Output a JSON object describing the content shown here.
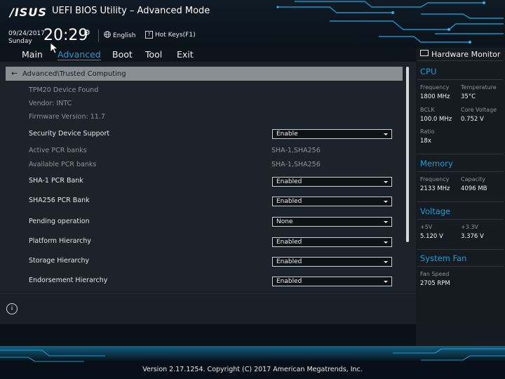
{
  "header": {
    "brand": "/ISUS",
    "title": "UEFI BIOS Utility – Advanced Mode",
    "date": "09/24/2017",
    "day": "Sunday",
    "time": "20:29",
    "language": "English",
    "hotkeys": "Hot Keys(F1)",
    "hotkeys_icon_glyph": "?"
  },
  "menu": {
    "items": [
      "Main",
      "Advanced",
      "Boot",
      "Tool",
      "Exit"
    ],
    "active": "Advanced"
  },
  "breadcrumb": "Advanced\\Trusted Computing",
  "settings": {
    "info": [
      "TPM20 Device Found",
      "Vendor: INTC",
      "Firmware Version: 11.7"
    ],
    "security_device_support": {
      "label": "Security Device Support",
      "value": "Enable"
    },
    "active_pcr": {
      "label": "Active PCR banks",
      "value": "SHA-1,SHA256"
    },
    "available_pcr": {
      "label": "Available PCR banks",
      "value": "SHA-1,SHA256"
    },
    "sha1_bank": {
      "label": "SHA-1 PCR Bank",
      "value": "Enabled"
    },
    "sha256_bank": {
      "label": "SHA256 PCR Bank",
      "value": "Enabled"
    },
    "pending_operation": {
      "label": "Pending operation",
      "value": "None"
    },
    "platform_hierarchy": {
      "label": "Platform Hierarchy",
      "value": "Enabled"
    },
    "storage_hierarchy": {
      "label": "Storage Hierarchy",
      "value": "Enabled"
    },
    "endorsement_hierarchy": {
      "label": "Endorsement Hierarchy",
      "value": "Enabled"
    }
  },
  "info_icon_glyph": "i",
  "hardware_monitor": {
    "title": "Hardware Monitor",
    "cpu": {
      "title": "CPU",
      "frequency_label": "Frequency",
      "frequency": "1800 MHz",
      "temperature_label": "Temperature",
      "temperature": "35°C",
      "bclk_label": "BCLK",
      "bclk": "100.0 MHz",
      "core_voltage_label": "Core Voltage",
      "core_voltage": "0.752 V",
      "ratio_label": "Ratio",
      "ratio": "18x"
    },
    "memory": {
      "title": "Memory",
      "frequency_label": "Frequency",
      "frequency": "2133 MHz",
      "capacity_label": "Capacity",
      "capacity": "4096 MB"
    },
    "voltage": {
      "title": "Voltage",
      "v5_label": "+5V",
      "v5": "5.120 V",
      "v33_label": "+3.3V",
      "v33": "3.376 V"
    },
    "system_fan": {
      "title": "System Fan",
      "speed_label": "Fan Speed",
      "speed": "2705 RPM"
    }
  },
  "footer": {
    "version": "Version 2.17.1254. Copyright (C) 2017 American Megatrends, Inc."
  },
  "colors": {
    "accent": "#1e9dd8",
    "background": "#0b1118",
    "panel": "#1c232a",
    "breadcrumb": "#8a8f94"
  }
}
